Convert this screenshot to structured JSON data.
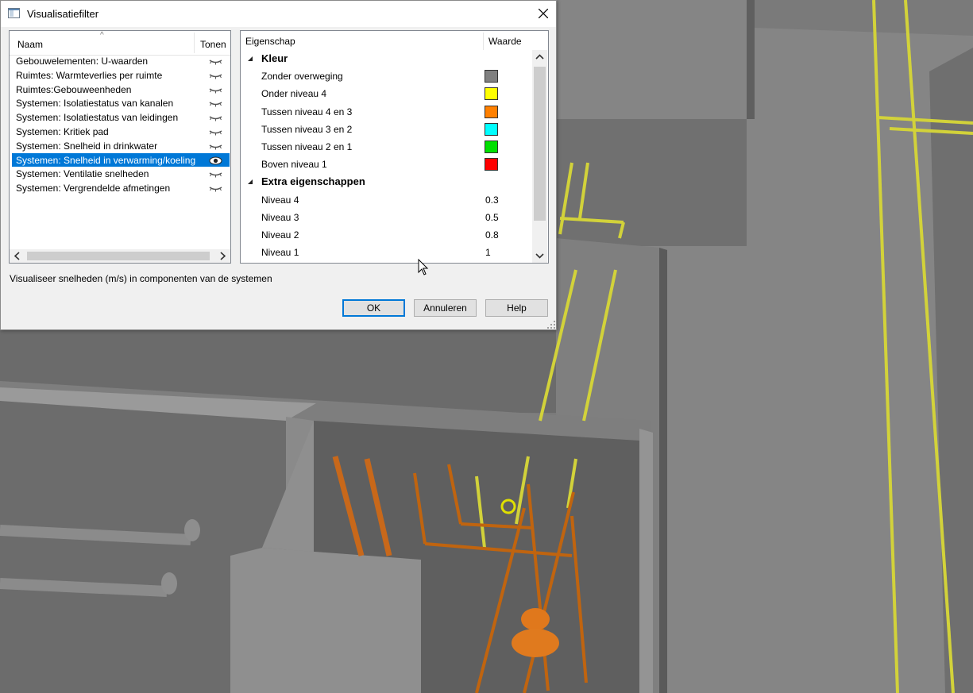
{
  "dialog": {
    "title": "Visualisatiefilter",
    "close_icon": "close-icon",
    "list": {
      "col_name": "Naam",
      "col_show": "Tonen",
      "sort_icon": "sort-up-icon",
      "items": [
        {
          "label": "Gebouwelementen: U-waarden",
          "selected": false
        },
        {
          "label": "Ruimtes: Warmteverlies per ruimte",
          "selected": false
        },
        {
          "label": "Ruimtes:Gebouweenheden",
          "selected": false
        },
        {
          "label": "Systemen: Isolatiestatus van kanalen",
          "selected": false
        },
        {
          "label": "Systemen: Isolatiestatus van leidingen",
          "selected": false
        },
        {
          "label": "Systemen: Kritiek pad",
          "selected": false
        },
        {
          "label": "Systemen: Snelheid in drinkwater",
          "selected": false
        },
        {
          "label": "Systemen: Snelheid in verwarming/koeling",
          "selected": true
        },
        {
          "label": "Systemen: Ventilatie snelheden",
          "selected": false
        },
        {
          "label": "Systemen: Vergrendelde afmetingen",
          "selected": false
        }
      ]
    },
    "properties": {
      "col_property": "Eigenschap",
      "col_value": "Waarde",
      "color_group": "Kleur",
      "color_rows": [
        {
          "label": "Zonder overweging",
          "color": "#808080"
        },
        {
          "label": "Onder niveau 4",
          "color": "#ffff00"
        },
        {
          "label": "Tussen niveau 4 en 3",
          "color": "#ff8000"
        },
        {
          "label": "Tussen niveau 3 en 2",
          "color": "#00ffff"
        },
        {
          "label": "Tussen niveau 2 en 1",
          "color": "#00e000"
        },
        {
          "label": "Boven niveau 1",
          "color": "#ff0000"
        }
      ],
      "extra_group": "Extra eigenschappen",
      "extra_rows": [
        {
          "label": "Niveau 4",
          "value": "0.3"
        },
        {
          "label": "Niveau 3",
          "value": "0.5"
        },
        {
          "label": "Niveau 2",
          "value": "0.8"
        },
        {
          "label": "Niveau 1",
          "value": "1"
        }
      ]
    },
    "description": "Visualiseer snelheden (m/s) in componenten van de systemen",
    "buttons": {
      "ok": "OK",
      "cancel": "Annuleren",
      "help": "Help"
    }
  },
  "scene_colors": {
    "background": "#7c7c7c",
    "wall_top": "#8c8c8c",
    "wall_side": "#6a6a6a",
    "yellow_pipe": "#d8d840",
    "orange_pipe": "#c86a14"
  }
}
